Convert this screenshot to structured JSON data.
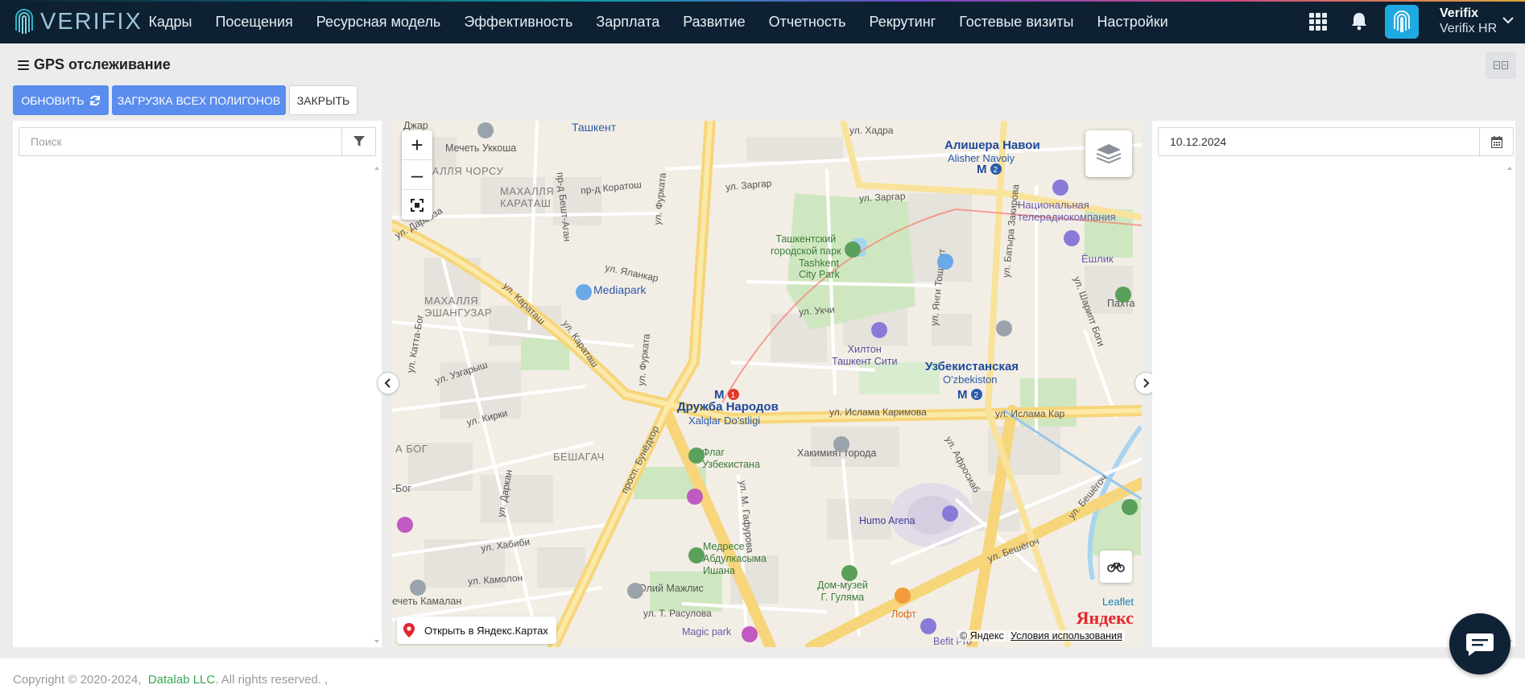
{
  "app": {
    "logo_text": "VERIFIX"
  },
  "nav": {
    "items": [
      {
        "label": "Кадры"
      },
      {
        "label": "Посещения"
      },
      {
        "label": "Ресурсная модель"
      },
      {
        "label": "Эффективность"
      },
      {
        "label": "Зарплата"
      },
      {
        "label": "Развитие"
      },
      {
        "label": "Отчетность"
      },
      {
        "label": "Рекрутинг"
      },
      {
        "label": "Гостевые визиты"
      },
      {
        "label": "Настройки"
      }
    ],
    "user_name": "Verifix",
    "user_org": "Verifix HR"
  },
  "page": {
    "title": "GPS отслеживание"
  },
  "toolbar": {
    "refresh_label": "ОБНОВИТЬ",
    "load_polygons_label": "ЗАГРУЗКА ВСЕХ ПОЛИГОНОВ",
    "close_label": "ЗАКРЫТЬ"
  },
  "left_panel": {
    "search_placeholder": "Поиск"
  },
  "right_panel": {
    "date_value": "10.12.2024"
  },
  "map": {
    "labels": {
      "tashkent": "Ташкент",
      "jar": "Джар",
      "mosque": "Мечеть Уккоша",
      "chorsu": "МАХАЛЛЯ ЧОРСУ",
      "karatash": "МАХАЛЛЯ\nКАРАТАШ",
      "koratosh": "пр-д Коратош",
      "zargar1": "ул. Заргар",
      "zargar2": "ул. Заргар",
      "khadra": "ул. Хадра",
      "navoi_ru": "Алишера Навои",
      "navoi_uz": "Alisher Navoiy",
      "tv": "Национальная\nтелерадиокомпания",
      "eshlik": "Ёшлик",
      "park_ru": "Ташкентский\nгородской парк",
      "park_en": "Tashkent\nCity Park",
      "darvoza": "ул. Дарвоза",
      "eshangu": "МАХАЛЛЯ\nЭШАНГУЗАР",
      "mediapark": "Mediapark",
      "yalangar": "ул. Яланкар",
      "furkata1": "ул. Фурката",
      "furkata2": "ул. Фурката",
      "ukchi": "ул. Укчи",
      "hilton_ru": "Хилтон\nТашкент Сити",
      "uzbekistan_ru": "Узбекистанская",
      "uzbekistan_uz": "O'zbekiston",
      "druzhba_ru": "Дружба Народов",
      "druzhba_uz": "Xalqlar Do'stligi",
      "karimova1": "ул. Ислама Каримова",
      "karimova2": "ул. Ислама Кар",
      "uzgarysh": "ул. Узгарыш",
      "kirki": "ул. Кирки",
      "bog": "А БОГ",
      "beshagach": "БЕШАГАЧ",
      "flag": "Флаг\nУзбекистана",
      "khokimiat": "Хакимият города",
      "humo": "Humo Arena",
      "medrese": "Медресе\nАбдулкасыма\nИшана",
      "oliy": "Олий Мажлис",
      "museum": "Дом-музей\nГ. Гуляма",
      "loft": "Лофт",
      "magic": "Magic park",
      "befit": "Befit Pro",
      "khabibi": "ул. Хабиби",
      "kamolon": "ул. Камолон",
      "kamalan": "ечеть Камалан",
      "rasulova": "ул. Т. Расулова",
      "bunyodkor": "просп. Бунёдкор",
      "gafurova": "ул. М. Гафурова",
      "afrosiab": "ул. Афросиаб",
      "beshyogoch1": "ул. Бешёгоч",
      "beshyogoch2": "ул. Бешёгоч",
      "batyr": "ул. Батыра Закирова",
      "toshkent": "ул. Янги Тошкент",
      "shirokaya": "ул. Шарипт Боги",
      "pakhta": "Пахта",
      "boga": "-Бог",
      "kattabog": "ул. Катта-Бог",
      "karatash_st": "ул. Караташ",
      "karatash_st2": "ул. Караташ",
      "dargan": "ул. Даркан",
      "bag": "пр-д Бешт-Аган"
    },
    "open_in_yandex": "Открыть в Яндекс.Картах",
    "yandex_copy": "© Яндекс",
    "terms": "Условия использования",
    "leaflet": "Leaflet",
    "yandex_logo": "Яндекс"
  },
  "footer": {
    "copyright": "Copyright © 2020-2024,",
    "company": "Datalab LLC",
    "rights": ". All rights reserved. ,"
  },
  "colors": {
    "navbar": "#0d2133",
    "primary": "#5b8def",
    "avatar": "#1fa9e1",
    "footer_link": "#3aa858"
  }
}
